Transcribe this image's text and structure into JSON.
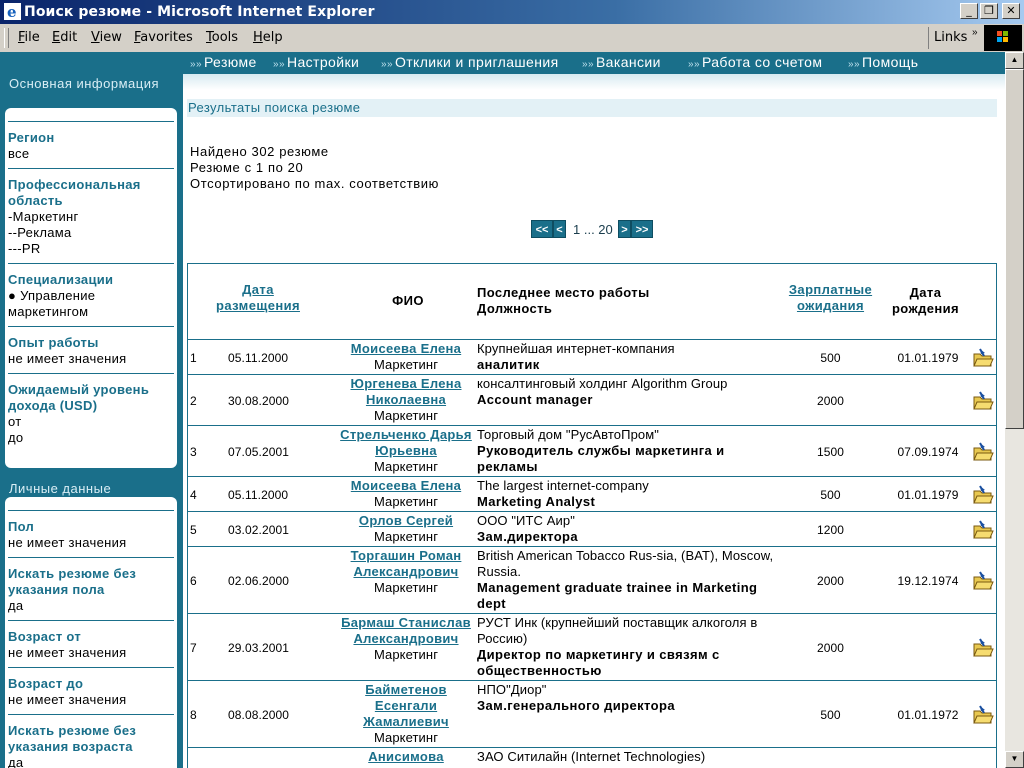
{
  "window": {
    "title": "Поиск резюме - Microsoft Internet Explorer"
  },
  "menu": [
    "File",
    "Edit",
    "View",
    "Favorites",
    "Tools",
    "Help"
  ],
  "links_label": "Links",
  "sidebar": {
    "main_header": "Основная информация",
    "main_blocks": [
      {
        "label": "Регион",
        "value": "все"
      },
      {
        "label": "Профессиональная область",
        "value": "-Маркетинг\n--Реклама\n---PR"
      },
      {
        "label": "Специализации",
        "value": "●  Управление маркетингом"
      },
      {
        "label": "Опыт работы",
        "value": "не имеет значения"
      },
      {
        "label": "Ожидаемый уровень дохода (USD)",
        "value": "от\nдо"
      }
    ],
    "personal_header": "Личные данные",
    "personal_blocks": [
      {
        "label": "Пол",
        "value": "не имеет значения"
      },
      {
        "label": "Искать резюме без указания пола",
        "value": "да"
      },
      {
        "label": "Возраст от",
        "value": "не имеет значения"
      },
      {
        "label": "Возраст до",
        "value": "не имеет значения"
      },
      {
        "label": "Искать резюме без указания возраста",
        "value": "да"
      }
    ]
  },
  "nav": [
    "Резюме",
    "Настройки",
    "Отклики и приглашения",
    "Вакансии",
    "Работа со счетом",
    "Помощь"
  ],
  "results": {
    "title": "Результаты поиска резюме",
    "found": "Найдено  302 резюме",
    "range": "Резюме с  1  по  20",
    "sorted": "Отсортировано по max. соответствию"
  },
  "pager": {
    "first": "<<",
    "prev": "<",
    "pages": "1 ... 20",
    "next": ">",
    "last": ">>"
  },
  "table": {
    "headers": {
      "date": "Дата размещения",
      "fio": "ФИО",
      "work": "Последнее место работы Должность",
      "salary": "Зарплатные ожидания",
      "birth": "Дата рождения"
    },
    "rows": [
      {
        "num": "1",
        "date": "05.11.2000",
        "name": "Моисеева Елена",
        "area": "Маркетинг",
        "company": "Крупнейшая интернет-компания",
        "position": "аналитик",
        "salary": "500",
        "birth": "01.01.1979"
      },
      {
        "num": "2",
        "date": "30.08.2000",
        "name": "Юргенева Елена Николаевна",
        "area": "Маркетинг",
        "company": "консалтинговый холдинг Algorithm Group",
        "position": "Account manager",
        "salary": "2000",
        "birth": ""
      },
      {
        "num": "3",
        "date": "07.05.2001",
        "name": "Стрельченко Дарья Юрьевна",
        "area": "Маркетинг",
        "company": "Торговый дом \"РусАвтоПром\"",
        "position": "Руководитель службы маркетинга и рекламы",
        "salary": "1500",
        "birth": "07.09.1974"
      },
      {
        "num": "4",
        "date": "05.11.2000",
        "name": "Моисеева Елена",
        "area": "Маркетинг",
        "company": "The largest internet-company",
        "position": "Marketing Analyst",
        "salary": "500",
        "birth": "01.01.1979"
      },
      {
        "num": "5",
        "date": "03.02.2001",
        "name": "Орлов Сергей",
        "area": "Маркетинг",
        "company": "ООО \"ИТС Аир\"",
        "position": "Зам.директора",
        "salary": "1200",
        "birth": ""
      },
      {
        "num": "6",
        "date": "02.06.2000",
        "name": "Торгашин Роман Александрович",
        "area": "Маркетинг",
        "company": "British American Tobacco Rus-sia, (BAT), Moscow, Russia.",
        "position": "Management graduate trainee in Marketing dept",
        "salary": "2000",
        "birth": "19.12.1974"
      },
      {
        "num": "7",
        "date": "29.03.2001",
        "name": "Бармаш Станислав Александрович",
        "area": "Маркетинг",
        "company": "РУСТ Инк (крупнейший поставщик алкоголя в Россию)",
        "position": "Директор по маркетингу и связям с общественностью",
        "salary": "2000",
        "birth": ""
      },
      {
        "num": "8",
        "date": "08.08.2000",
        "name": "Байметенов Есенгали Жамалиевич",
        "area": "Маркетинг",
        "company": "НПО\"Диор\"",
        "position": "Зам.генерального директора",
        "salary": "500",
        "birth": "01.01.1972"
      },
      {
        "num": "",
        "date": "",
        "name": "Анисимова",
        "area": "",
        "company": "ЗАО Ситилайн (Internet Technologies)",
        "position": "",
        "salary": "",
        "birth": ""
      }
    ]
  },
  "colors": {
    "accent": "#1a6f8a",
    "title_bar": "#0a246a"
  }
}
